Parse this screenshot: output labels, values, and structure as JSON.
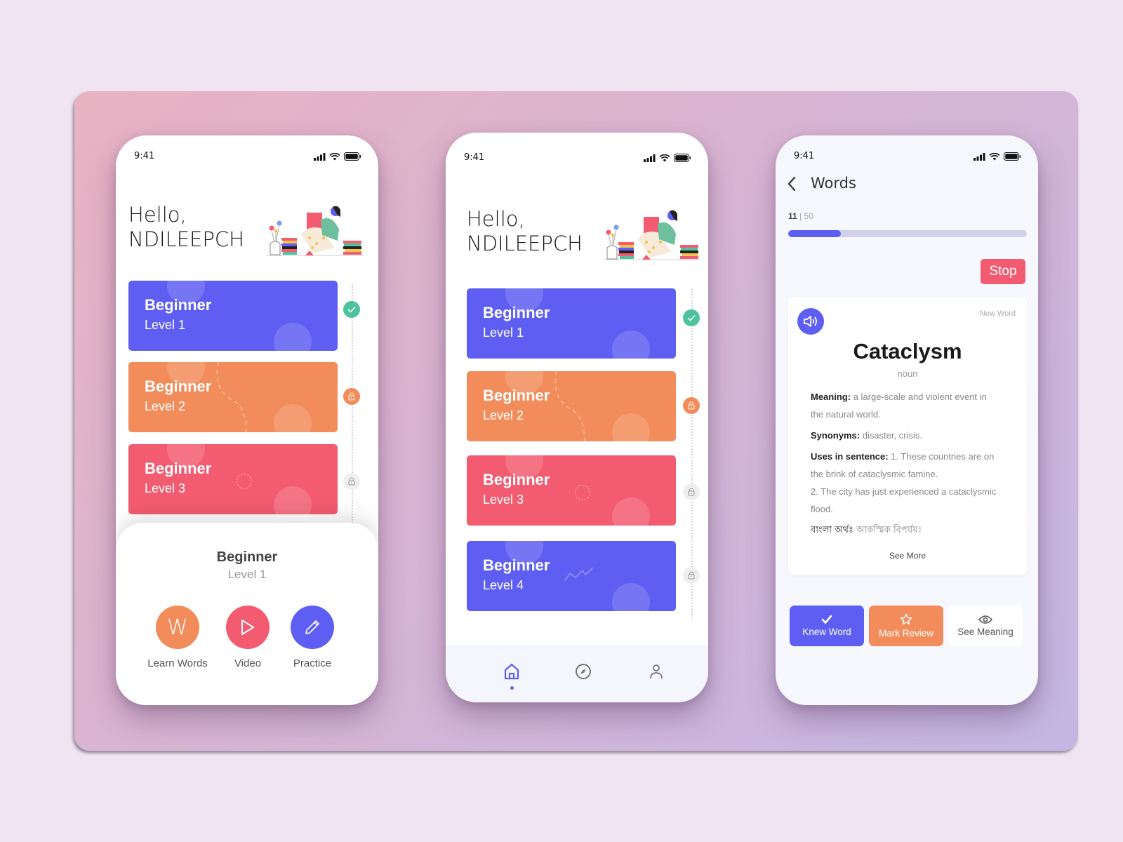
{
  "colors": {
    "background": "#f1e4f2",
    "primary": "#5f5ef2",
    "orange": "#f28c5b",
    "red": "#f25b70",
    "green": "#4ec29e"
  },
  "status_bar": {
    "time": "9:41"
  },
  "home": {
    "greeting": "Hello,",
    "username": "NDILEEPCH",
    "illustration": "woman-reading-books-illustration",
    "levels": [
      {
        "title": "Beginner",
        "subtitle": "Level 1",
        "color": "#5f5ef2",
        "status": "completed",
        "status_icon": "check-icon"
      },
      {
        "title": "Beginner",
        "subtitle": "Level 2",
        "color": "#f28c5b",
        "status": "unlocked",
        "status_icon": "unlock-icon"
      },
      {
        "title": "Beginner",
        "subtitle": "Level 3",
        "color": "#f25b70",
        "status": "locked",
        "status_icon": "lock-icon"
      },
      {
        "title": "Beginner",
        "subtitle": "Level 4",
        "color": "#5f5ef2",
        "status": "locked",
        "status_icon": "lock-icon"
      }
    ]
  },
  "level_sheet": {
    "title": "Beginner",
    "subtitle": "Level 1",
    "actions": [
      {
        "label": "Learn Words",
        "icon": "letter-w-icon",
        "glyph": "W",
        "color": "#f28c5b"
      },
      {
        "label": "Video",
        "icon": "play-icon",
        "color": "#f25b70"
      },
      {
        "label": "Practice",
        "icon": "pencil-icon",
        "color": "#5f5ef2"
      }
    ]
  },
  "tabbar": {
    "tabs": [
      {
        "name": "home",
        "icon": "home-icon",
        "active": true
      },
      {
        "name": "explore",
        "icon": "compass-icon",
        "active": false
      },
      {
        "name": "profile",
        "icon": "user-icon",
        "active": false
      }
    ]
  },
  "words": {
    "title": "Words",
    "progress": {
      "current": "11",
      "separator": "|",
      "total": "50",
      "fraction": 0.22
    },
    "stop_label": "Stop",
    "card": {
      "tag": "New Word",
      "word": "Cataclysm",
      "part_of_speech": "noun",
      "meaning_label": "Meaning:",
      "meaning": "a large-scale and violent event in the natural world.",
      "synonyms_label": "Synonyms:",
      "synonyms": "disaster, crisis.",
      "uses_label": "Uses in sentence:",
      "uses_1": "1. These countries are on the brink of cataclysmic famine.",
      "uses_2": "2. The city has just experienced a cataclysmic flood.",
      "bangla_label": "বাংলা অর্থঃ",
      "bangla": "আকস্মিক বিপর্যয়।",
      "see_more": "See More"
    },
    "buttons": [
      {
        "label": "Knew Word",
        "icon": "check-icon"
      },
      {
        "label": "Mark Review",
        "icon": "star-icon"
      },
      {
        "label": "See Meaning",
        "icon": "eye-icon"
      }
    ]
  }
}
